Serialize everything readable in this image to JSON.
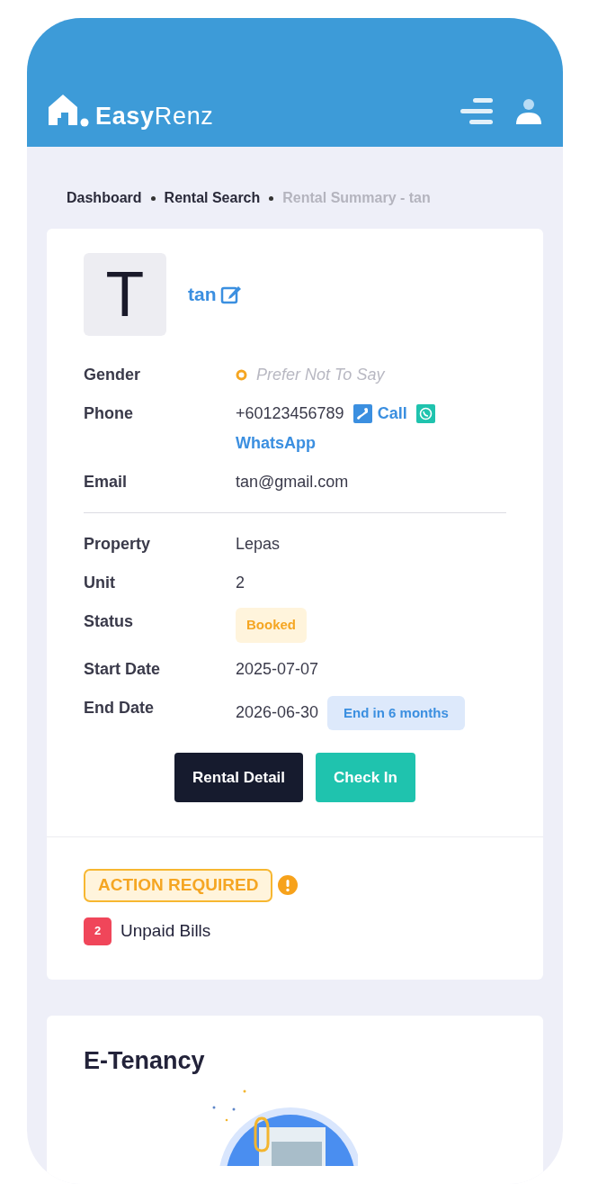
{
  "brand": "**Easy**Renz",
  "breadcrumbs": [
    {
      "label": "Dashboard",
      "selected": false
    },
    {
      "label": "Rental Search",
      "selected": false
    },
    {
      "label": "Rental Summary - tan",
      "selected": true
    }
  ],
  "profile": {
    "initial": "T",
    "name": "tan"
  },
  "contact_fields": [
    {
      "kind": "gender",
      "label": "Gender",
      "value": "Prefer Not To Say"
    },
    {
      "kind": "phone",
      "label": "Phone",
      "value": "+60123456789",
      "call": "Call",
      "whatsapp": "WhatsApp"
    },
    {
      "kind": "text",
      "label": "Email",
      "value": "tan@gmail.com"
    }
  ],
  "rental_fields": [
    {
      "kind": "text",
      "label": "Property",
      "value": "Lepas"
    },
    {
      "kind": "text",
      "label": "Unit",
      "value": "2"
    },
    {
      "kind": "badge",
      "label": "Status",
      "value": "Booked"
    },
    {
      "kind": "text",
      "label": "Start Date",
      "value": "2025-07-07"
    },
    {
      "kind": "tagged",
      "label": "End Date",
      "value": "2026-06-30",
      "tag": "End in 6 months"
    }
  ],
  "buttons": [
    {
      "label": "Rental Detail",
      "kind": "dark"
    },
    {
      "label": "Check In",
      "kind": "teal"
    }
  ],
  "action": {
    "label": "ACTION REQUIRED",
    "items": [
      {
        "count": "2",
        "label": "Unpaid Bills"
      }
    ]
  },
  "etenancy": {
    "title": "E-Tenancy"
  }
}
